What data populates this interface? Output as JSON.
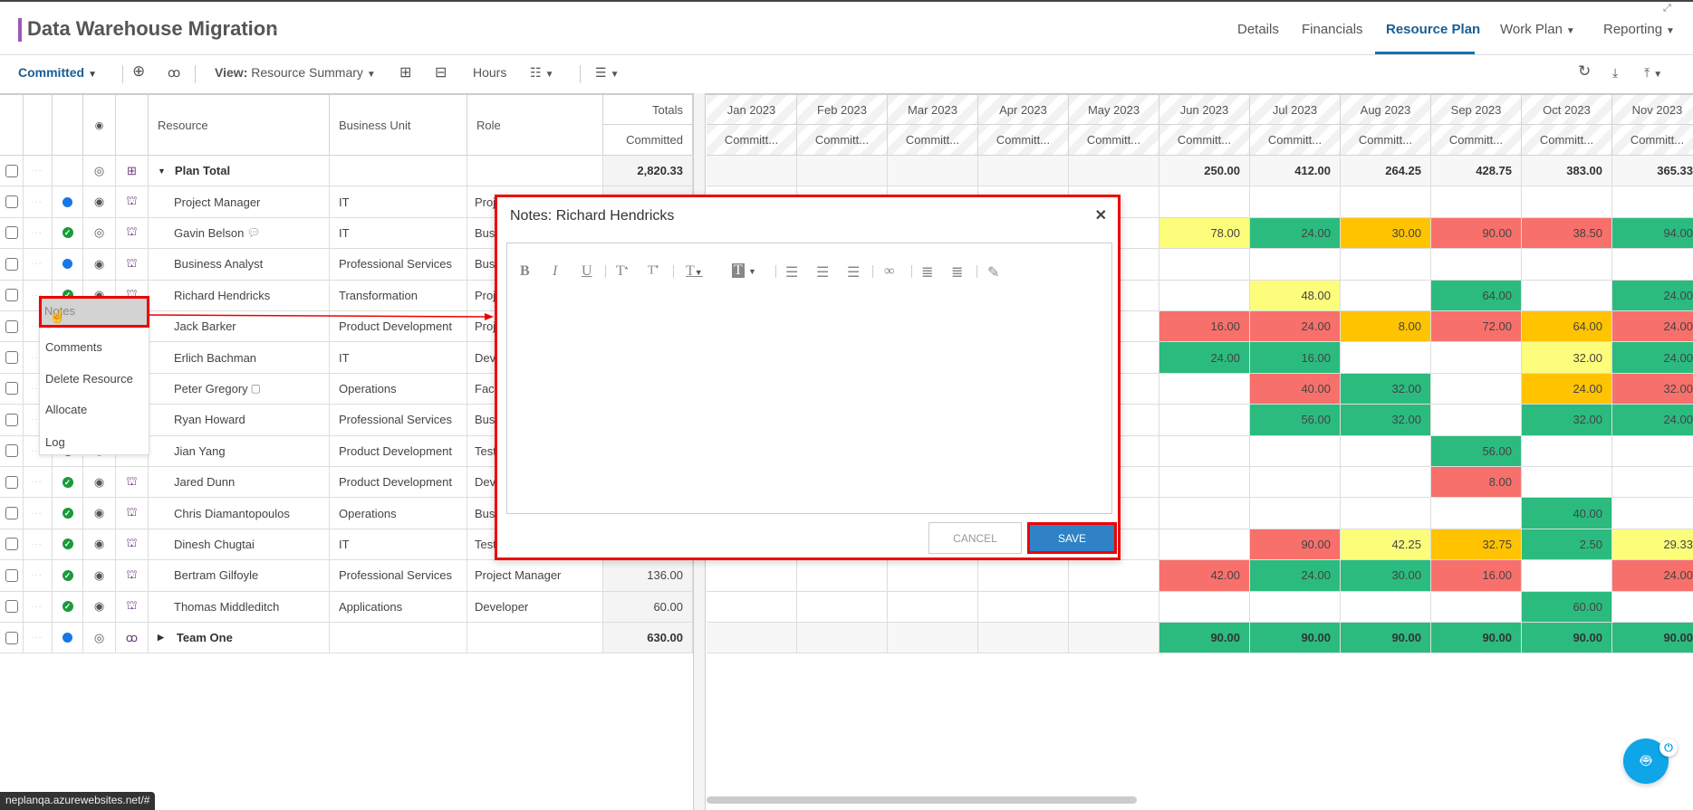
{
  "header": {
    "title": "Data Warehouse Migration",
    "more": "···",
    "tabs": [
      {
        "label": "Details"
      },
      {
        "label": "Financials"
      },
      {
        "label": "Resource Plan",
        "active": true
      },
      {
        "label": "Work Plan",
        "dropdown": true
      },
      {
        "label": "Reporting",
        "dropdown": true
      }
    ]
  },
  "toolbar": {
    "committed": "Committed",
    "view_label": "View:",
    "view_value": "Resource Summary",
    "hours": "Hours"
  },
  "grid": {
    "headers": {
      "resource": "Resource",
      "business_unit": "Business Unit",
      "role": "Role",
      "totals": "Totals",
      "totals_sub": "Committed"
    },
    "months": [
      "Jan 2023",
      "Feb 2023",
      "Mar 2023",
      "Apr 2023",
      "May 2023",
      "Jun 2023",
      "Jul 2023",
      "Aug 2023",
      "Sep 2023",
      "Oct 2023",
      "Nov 2023"
    ],
    "month_sub": "Committ...",
    "colors": {
      "green": "#2bbb7f",
      "red": "#f8706b",
      "orange": "#ffc300",
      "yellow": "#fdfd7c"
    },
    "rows": [
      {
        "name": "Plan Total",
        "type": "total",
        "eye": "eye-off",
        "icon": "structure",
        "bu": "",
        "role": "",
        "total": "2,820.33",
        "cells": {
          "Jun 2023": [
            "250.00",
            ""
          ],
          "Jul 2023": [
            "412.00",
            ""
          ],
          "Aug 2023": [
            "264.25",
            ""
          ],
          "Sep 2023": [
            "428.75",
            ""
          ],
          "Oct 2023": [
            "383.00",
            ""
          ],
          "Nov 2023": [
            "365.33",
            ""
          ]
        }
      },
      {
        "name": "Project Manager",
        "status": "dot",
        "eye": "eye",
        "icon": "robot",
        "bu": "IT",
        "role": "Proj",
        "total": "",
        "cells": {}
      },
      {
        "name": "Gavin Belson",
        "status": "check",
        "eye": "eye-off",
        "icon": "robot",
        "comment": "comment-dots",
        "bu": "IT",
        "role": "Busi",
        "total": "",
        "cells": {
          "Jun 2023": [
            "78.00",
            "yellow"
          ],
          "Jul 2023": [
            "24.00",
            "green"
          ],
          "Aug 2023": [
            "30.00",
            "orange"
          ],
          "Sep 2023": [
            "90.00",
            "red"
          ],
          "Oct 2023": [
            "38.50",
            "red"
          ],
          "Nov 2023": [
            "94.00",
            "green"
          ]
        }
      },
      {
        "name": "Business Analyst",
        "status": "dot",
        "eye": "eye",
        "icon": "robot",
        "bu": "Professional Services",
        "role": "Busi",
        "total": "",
        "cells": {}
      },
      {
        "name": "Richard Hendricks",
        "status": "check",
        "eye": "eye",
        "icon": "robot",
        "bu": "Transformation",
        "role": "Proj",
        "total": "",
        "cells": {
          "Jul 2023": [
            "48.00",
            "yellow"
          ],
          "Sep 2023": [
            "64.00",
            "green"
          ],
          "Nov 2023": [
            "24.00",
            "green"
          ]
        }
      },
      {
        "name": "Jack Barker",
        "status": "check",
        "eye": "eye",
        "icon": "robot",
        "bu": "Product Development",
        "role": "Proj",
        "total": "",
        "cells": {
          "Jun 2023": [
            "16.00",
            "red"
          ],
          "Jul 2023": [
            "24.00",
            "red"
          ],
          "Aug 2023": [
            "8.00",
            "orange"
          ],
          "Sep 2023": [
            "72.00",
            "red"
          ],
          "Oct 2023": [
            "64.00",
            "orange"
          ],
          "Nov 2023": [
            "24.00",
            "red"
          ]
        }
      },
      {
        "name": "Erlich Bachman",
        "status": "check",
        "eye": "eye",
        "icon": "robot",
        "bu": "IT",
        "role": "Dev",
        "total": "",
        "cells": {
          "Jun 2023": [
            "24.00",
            "green"
          ],
          "Jul 2023": [
            "16.00",
            "green"
          ],
          "Oct 2023": [
            "32.00",
            "yellow"
          ],
          "Nov 2023": [
            "24.00",
            "green"
          ]
        }
      },
      {
        "name": "Peter Gregory",
        "status": "check",
        "eye": "eye",
        "icon": "robot",
        "comment": "comment",
        "bu": "Operations",
        "role": "Faci",
        "total": "",
        "cells": {
          "Jul 2023": [
            "40.00",
            "red"
          ],
          "Aug 2023": [
            "32.00",
            "green"
          ],
          "Oct 2023": [
            "24.00",
            "orange"
          ],
          "Nov 2023": [
            "32.00",
            "red"
          ]
        }
      },
      {
        "name": "Ryan Howard",
        "status": "check",
        "eye": "eye",
        "icon": "robot",
        "bu": "Professional Services",
        "role": "Busi",
        "total": "",
        "cells": {
          "Jul 2023": [
            "56.00",
            "green"
          ],
          "Aug 2023": [
            "32.00",
            "green"
          ],
          "Oct 2023": [
            "32.00",
            "green"
          ],
          "Nov 2023": [
            "24.00",
            "green"
          ]
        }
      },
      {
        "name": "Jian Yang",
        "status": "check",
        "eye": "eye",
        "icon": "robot",
        "bu": "Product Development",
        "role": "Test",
        "total": "",
        "cells": {
          "Sep 2023": [
            "56.00",
            "green"
          ]
        }
      },
      {
        "name": "Jared Dunn",
        "status": "check",
        "eye": "eye",
        "icon": "robot",
        "bu": "Product Development",
        "role": "Dev",
        "total": "",
        "cells": {
          "Sep 2023": [
            "8.00",
            "red"
          ]
        }
      },
      {
        "name": "Chris Diamantopoulos",
        "status": "check",
        "eye": "eye",
        "icon": "robot",
        "bu": "Operations",
        "role": "Busi",
        "total": "",
        "cells": {
          "Oct 2023": [
            "40.00",
            "green"
          ]
        }
      },
      {
        "name": "Dinesh Chugtai",
        "status": "check",
        "eye": "eye",
        "icon": "robot",
        "bu": "IT",
        "role": "Test",
        "total": "",
        "cells": {
          "Jul 2023": [
            "90.00",
            "red"
          ],
          "Aug 2023": [
            "42.25",
            "yellow"
          ],
          "Sep 2023": [
            "32.75",
            "orange"
          ],
          "Oct 2023": [
            "2.50",
            "green"
          ],
          "Nov 2023": [
            "29.33",
            "yellow"
          ]
        }
      },
      {
        "name": "Bertram Gilfoyle",
        "status": "check",
        "eye": "eye",
        "icon": "robot",
        "bu": "Professional Services",
        "role": "Project Manager",
        "total": "136.00",
        "cells": {
          "Jun 2023": [
            "42.00",
            "red"
          ],
          "Jul 2023": [
            "24.00",
            "green"
          ],
          "Aug 2023": [
            "30.00",
            "green"
          ],
          "Sep 2023": [
            "16.00",
            "red"
          ],
          "Nov 2023": [
            "24.00",
            "red"
          ]
        }
      },
      {
        "name": "Thomas Middleditch",
        "status": "check",
        "eye": "eye",
        "icon": "robot",
        "bu": "Applications",
        "role": "Developer",
        "total": "60.00",
        "cells": {
          "Oct 2023": [
            "60.00",
            "green"
          ]
        }
      },
      {
        "name": "Team One",
        "type": "group",
        "status": "dot",
        "eye": "eye-off",
        "icon": "group",
        "bu": "",
        "role": "",
        "total": "630.00",
        "cells": {
          "Jun 2023": [
            "90.00",
            "green"
          ],
          "Jul 2023": [
            "90.00",
            "green"
          ],
          "Aug 2023": [
            "90.00",
            "green"
          ],
          "Sep 2023": [
            "90.00",
            "green"
          ],
          "Oct 2023": [
            "90.00",
            "green"
          ],
          "Nov 2023": [
            "90.00",
            "green"
          ]
        }
      }
    ]
  },
  "context_menu": {
    "items": [
      "Notes",
      "Comments",
      "Delete Resource",
      "Allocate",
      "Log"
    ]
  },
  "modal": {
    "title": "Notes: Richard Hendricks",
    "cancel": "CANCEL",
    "save": "SAVE",
    "content": ""
  },
  "status_url": "neplanqa.azurewebsites.net/#"
}
